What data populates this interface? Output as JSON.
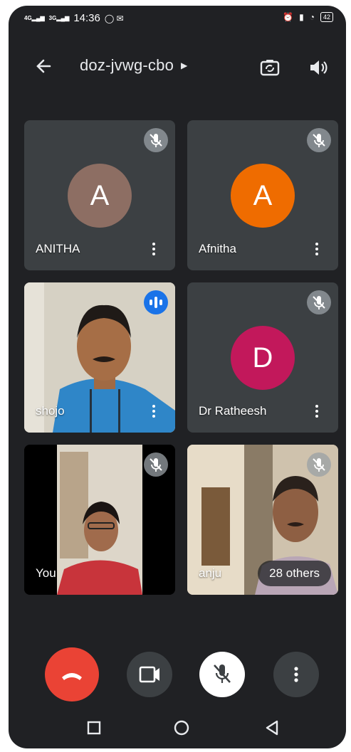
{
  "status_bar": {
    "net1": "4G",
    "net2": "3G",
    "time": "14:36",
    "battery": "42"
  },
  "header": {
    "meeting_code": "doz-jvwg-cbo"
  },
  "participants": [
    {
      "name": "ANITHA",
      "initial": "A",
      "avatar_color": "#8d6e63",
      "muted": true
    },
    {
      "name": "Afnitha",
      "initial": "A",
      "avatar_color": "#ef6c00",
      "muted": true
    },
    {
      "name": "shojo",
      "video": true,
      "speaking": true
    },
    {
      "name": "Dr Ratheesh",
      "initial": "D",
      "avatar_color": "#c2185b",
      "muted": true
    },
    {
      "name": "You",
      "video": true,
      "muted": true
    },
    {
      "name": "anju",
      "video": true,
      "muted": true,
      "others_label": "28 others"
    }
  ],
  "colors": {
    "background": "#202124",
    "tile": "#3c4043",
    "end_call": "#ea4335",
    "speaking": "#1a73e8"
  }
}
